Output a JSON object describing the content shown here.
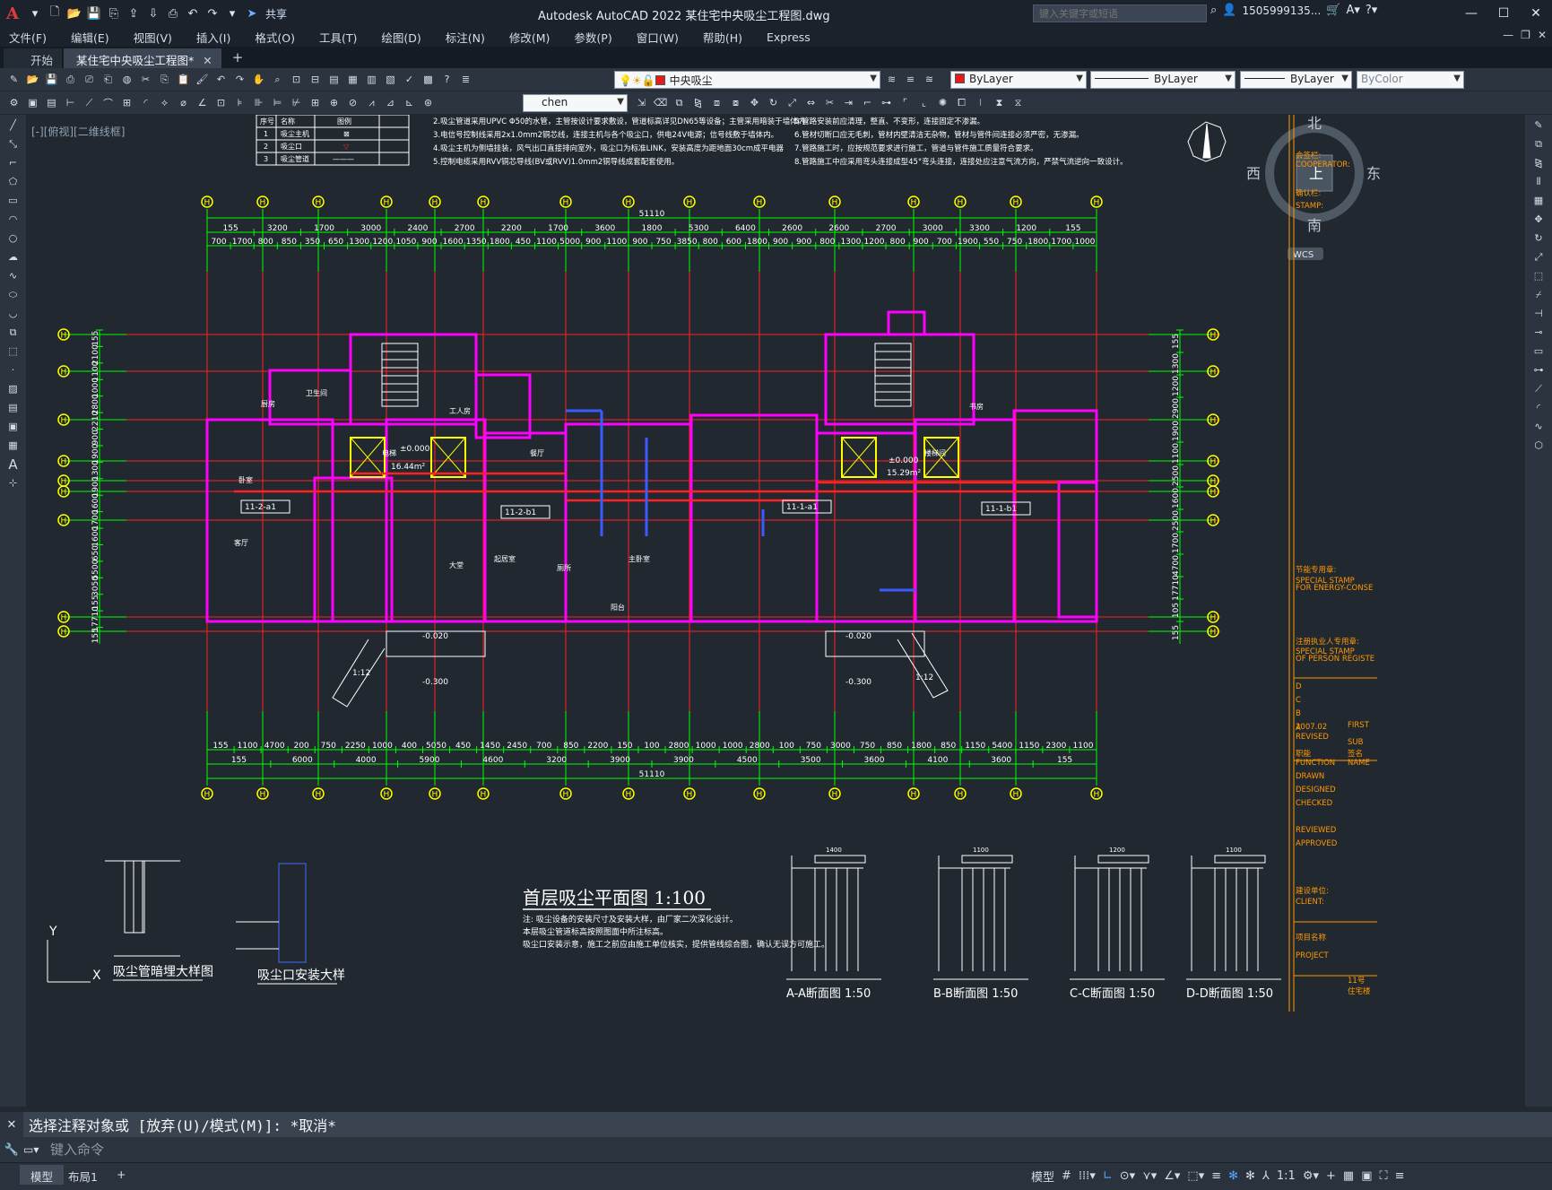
{
  "app": {
    "title": "Autodesk AutoCAD 2022    某住宅中央吸尘工程图.dwg",
    "share_label": "共享",
    "search_placeholder": "键入关键字或短语",
    "user": "1505999135...",
    "logo": "A"
  },
  "menu": [
    "文件(F)",
    "编辑(E)",
    "视图(V)",
    "插入(I)",
    "格式(O)",
    "工具(T)",
    "绘图(D)",
    "标注(N)",
    "修改(M)",
    "参数(P)",
    "窗口(W)",
    "帮助(H)",
    "Express"
  ],
  "tabs": [
    {
      "label": "开始",
      "active": false
    },
    {
      "label": "某住宅中央吸尘工程图*",
      "active": true
    }
  ],
  "toolbar": {
    "layer": "中央吸尘",
    "color": "ByLayer",
    "linetype": "ByLayer",
    "lineweight": "ByLayer",
    "plotstyle": "ByColor",
    "textstyle": "chen"
  },
  "viewport": {
    "label": "[-][俯视][二维线框]"
  },
  "compass": {
    "north": "北",
    "south": "南",
    "east": "东",
    "west": "西",
    "center": "上",
    "wcs": "WCS"
  },
  "drawing": {
    "title": "首层吸尘平面图  1:100",
    "notes": [
      "注: 吸尘设备的安装尺寸及安装大样，由厂家二次深化设计。",
      "本层吸尘管道标高按照图面中所注标高。",
      "吸尘口安装示意，施工之前应由施工单位核实，提供管线综合图，确认无误方可施工。"
    ],
    "top_notes": [
      "2.吸尘管道采用UPVC Φ50的水管，主管按设计要求敷设，管道标高详见DN65等设备；主管采用暗装于墙体内。",
      "3.电信号控制线采用2x1.0mm2铜芯线，连接主机与各个吸尘口，供电24V电源；信号线敷于墙体内。",
      "4.吸尘主机为侧墙挂装，风气出口直接排向室外，吸尘口为标准LINK，安装高度为距地面30cm成平电器",
      "5.控制电缆采用RVV铜芯导线(BV或RVV)1.0mm2铜导线成套配套使用。",
      "5.管路安装前应清理，整直、不变形，连接固定不渗漏。",
      "6.管材切断口应无毛刺，管材内壁清洁无杂物，管材与管件间连接必须严密，无渗漏。",
      "7.管路施工时，应按规范要求进行施工，管道与管件施工质量符合要求。",
      "8.管路施工中应采用弯头连接成型45°弯头连接，连接处应注意气流方向，严禁气流逆向一致设计。"
    ],
    "dims_top_total": "51110",
    "dims_top_row1": [
      "155",
      "3200",
      "1700",
      "3000",
      "2400",
      "2700",
      "2200",
      "1700",
      "3600",
      "1800",
      "5300",
      "6400",
      "2600",
      "2600",
      "2700",
      "3000",
      "3300",
      "1200",
      "155"
    ],
    "dims_top_row2": [
      "700",
      "1700",
      "800",
      "850",
      "350",
      "650",
      "1300",
      "1200",
      "1050",
      "900",
      "1600",
      "1350",
      "1800",
      "450",
      "1100",
      "5000",
      "900",
      "1100",
      "900",
      "750",
      "3850",
      "800",
      "600",
      "1800",
      "900",
      "900",
      "800",
      "1300",
      "1200",
      "800",
      "900",
      "700",
      "1900",
      "550",
      "750",
      "1800",
      "1700",
      "1000"
    ],
    "dims_bottom_total": "51110",
    "dims_bottom_row1": [
      "155",
      "6000",
      "4000",
      "5900",
      "4600",
      "3200",
      "3900",
      "3900",
      "4500",
      "3500",
      "3600",
      "4100",
      "3600",
      "155"
    ],
    "dims_bottom_row2": [
      "155",
      "1100",
      "4700",
      "200",
      "750",
      "2250",
      "1000",
      "400",
      "5050",
      "450",
      "1450",
      "2450",
      "700",
      "850",
      "2200",
      "150",
      "100",
      "2800",
      "1000",
      "1000",
      "2800",
      "100",
      "750",
      "3000",
      "750",
      "850",
      "1800",
      "850",
      "1150",
      "5400",
      "1150",
      "2300",
      "1100"
    ],
    "dims_left": [
      "155",
      "2100",
      "1100",
      "1000",
      "2800",
      "2210",
      "900",
      "1900",
      "1300",
      "1900",
      "1600",
      "1700",
      "1600",
      "650",
      "5500",
      "3050",
      "155",
      "17710",
      "155"
    ],
    "dims_right": [
      "155",
      "1300",
      "1200",
      "2900",
      "1900",
      "1100",
      "2500",
      "1600",
      "2500",
      "1700",
      "4700",
      "17710",
      "105",
      "155"
    ],
    "rooms": [
      "卧室",
      "厨房",
      "餐厅",
      "起居室",
      "客厅",
      "大堂",
      "卫生间",
      "工人房",
      "主卧室",
      "阳台",
      "厕所",
      "书房",
      "楼梯间",
      "电梯"
    ],
    "unit_labels": [
      "11-2-a1",
      "11-2-b1",
      "11-1-a1",
      "11-1-b1"
    ],
    "elev_labels": [
      "±0.000",
      "16.44m²",
      "±0.000",
      "15.29m²",
      "-0.020",
      "-0.300",
      "-0.020",
      "-0.300",
      "1:12",
      "1:12"
    ],
    "section_labels": [
      "A-A断面图 1:50",
      "B-B断面图 1:50",
      "C-C断面图 1:50",
      "D-D断面图 1:50"
    ],
    "detail_labels": [
      "吸尘管暗埋大样图",
      "吸尘口安装大样"
    ],
    "section_dims": [
      "1400",
      "1100",
      "1200",
      "1100"
    ],
    "legend": {
      "headers": [
        "序号",
        "名称",
        "图例"
      ],
      "rows": [
        [
          "1",
          "吸尘主机",
          "⊠"
        ],
        [
          "2",
          "吸尘口",
          "▽"
        ],
        [
          "3",
          "吸尘管道",
          "———"
        ]
      ]
    },
    "titleblock": [
      "会签栏:",
      "COOPERATOR:",
      "确认栏:",
      "STAMP:",
      "节能专用章:",
      "SPECIAL STAMP",
      "FOR ENERGY-CONSE",
      "注册执业人专用章:",
      "SPECIAL STAMP",
      "OF PERSON REGISTE",
      "D",
      "C",
      "B",
      "A",
      "2007.02",
      "FIRST",
      "REVISED",
      "SUB",
      "职能",
      "签名",
      "FUNCTION",
      "NAME",
      "DRAWN",
      "DESIGNED",
      "CHECKED",
      "REVIEWED",
      "APPROVED",
      "建设单位:",
      "CLIENT:",
      "项目名称",
      "PROJECT",
      "11号",
      "住宅楼"
    ]
  },
  "command": {
    "history": "选择注释对象或 [放弃(U)/模式(M)]: *取消*",
    "placeholder": "键入命令"
  },
  "layout_tabs": [
    "模型",
    "布局1"
  ],
  "status": {
    "model": "模型",
    "scale": "1:1"
  },
  "colors": {
    "bg": "#212830",
    "grid": "#00ff00",
    "axis": "#ff0000",
    "wall": "#ff00ff",
    "accent": "#56a6ff",
    "yellow": "#ffff00",
    "white": "#ffffff"
  }
}
